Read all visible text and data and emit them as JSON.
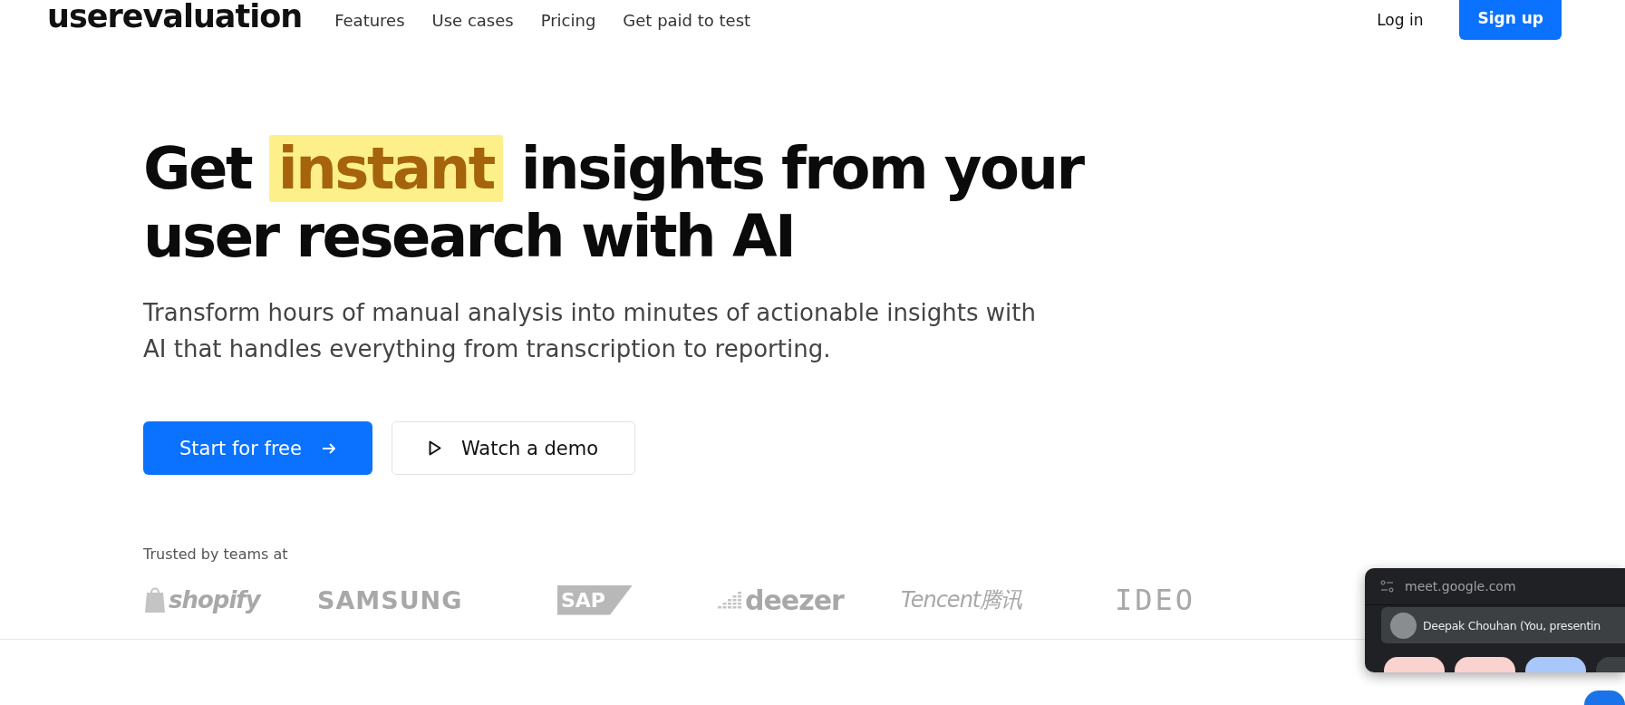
{
  "header": {
    "logo": "userevaluation",
    "nav": [
      "Features",
      "Use cases",
      "Pricing",
      "Get paid to test"
    ],
    "login": "Log in",
    "signup": "Sign up"
  },
  "hero": {
    "headline_before": "Get",
    "headline_highlight": "instant",
    "headline_after": "insights from your user research with AI",
    "subtitle": "Transform hours of manual analysis into minutes of actionable insights with AI that handles everything from transcription to reporting.",
    "primary_button": "Start for free",
    "secondary_button": "Watch a demo"
  },
  "trusted": {
    "label": "Trusted by teams at",
    "logos": [
      {
        "kind": "shopify",
        "text": "shopify"
      },
      {
        "kind": "samsung",
        "text": "SAMSUNG"
      },
      {
        "kind": "sap",
        "text": "SAP"
      },
      {
        "kind": "deezer",
        "text": "deezer"
      },
      {
        "kind": "tencent",
        "text": "Tencent腾讯"
      },
      {
        "kind": "ideo",
        "text": "IDEO"
      }
    ]
  },
  "meet_popup": {
    "url": "meet.google.com",
    "presenter": "Deepak Chouhan (You, presentin"
  }
}
